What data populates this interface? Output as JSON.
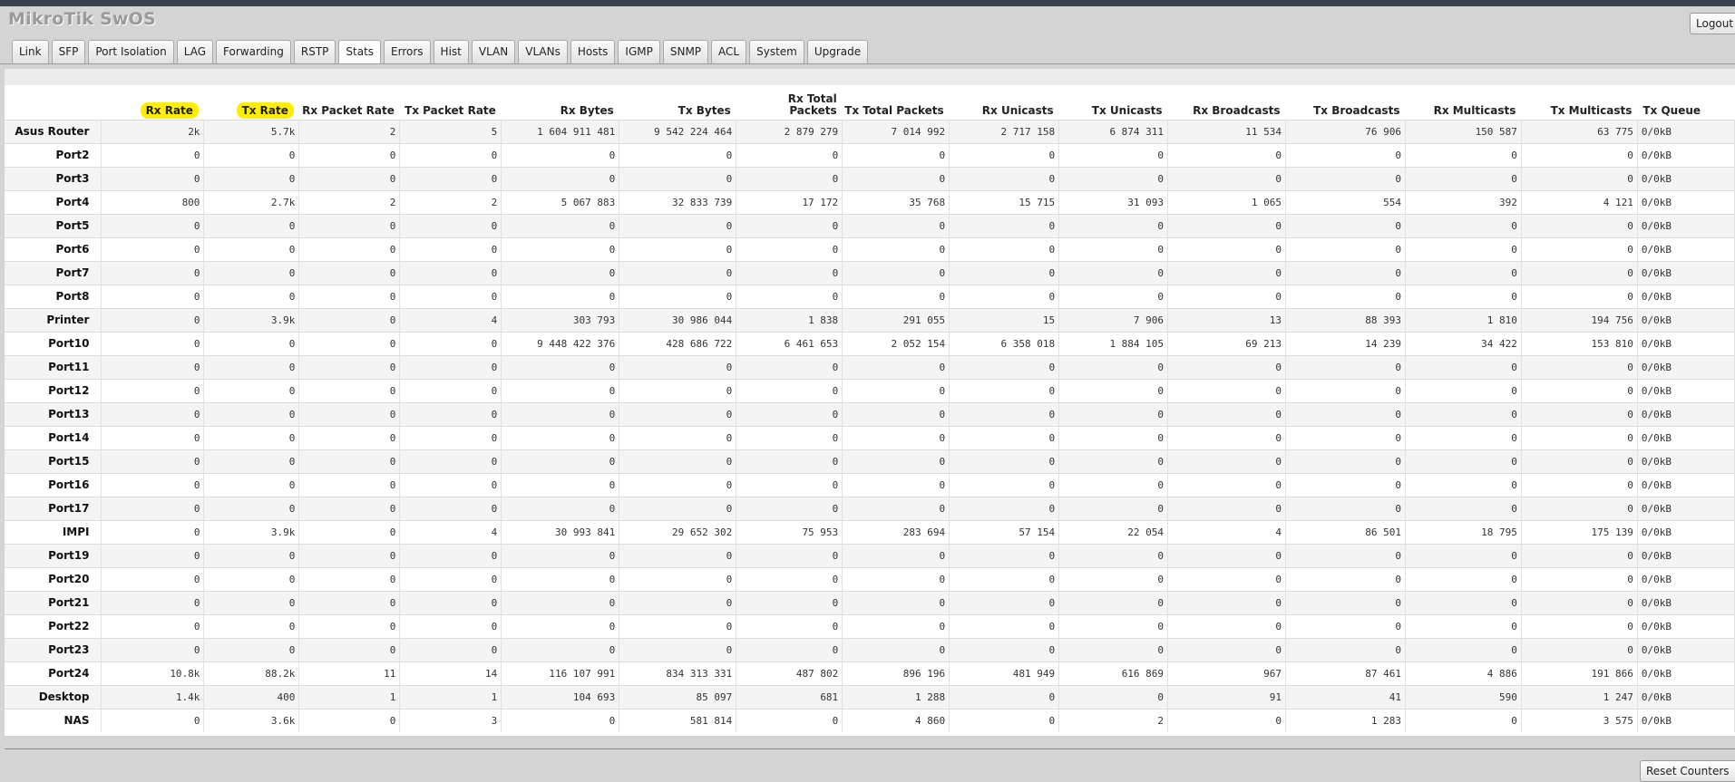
{
  "app_title": "MikroTik SwOS",
  "logout_label": "Logout",
  "reset_label": "Reset Counters",
  "tabs": [
    {
      "label": "Link"
    },
    {
      "label": "SFP"
    },
    {
      "label": "Port Isolation"
    },
    {
      "label": "LAG"
    },
    {
      "label": "Forwarding"
    },
    {
      "label": "RSTP"
    },
    {
      "label": "Stats",
      "active": true
    },
    {
      "label": "Errors"
    },
    {
      "label": "Hist"
    },
    {
      "label": "VLAN"
    },
    {
      "label": "VLANs"
    },
    {
      "label": "Hosts"
    },
    {
      "label": "IGMP"
    },
    {
      "label": "SNMP"
    },
    {
      "label": "ACL"
    },
    {
      "label": "System"
    },
    {
      "label": "Upgrade"
    }
  ],
  "highlight_color": "#ffee00",
  "table": {
    "columns": [
      "",
      "Rx Rate",
      "Tx Rate",
      "Rx Packet Rate",
      "Tx Packet Rate",
      "Rx Bytes",
      "Tx Bytes",
      "Rx Total Packets",
      "Tx Total Packets",
      "Rx Unicasts",
      "Tx Unicasts",
      "Rx Broadcasts",
      "Tx Broadcasts",
      "Rx Multicasts",
      "Tx Multicasts",
      "Tx Queue"
    ],
    "highlighted_columns": [
      1,
      2
    ],
    "rows": [
      [
        "Asus Router",
        "2k",
        "5.7k",
        "2",
        "5",
        "1 604 911 481",
        "9 542 224 464",
        "2 879 279",
        "7 014 992",
        "2 717 158",
        "6 874 311",
        "11 534",
        "76 906",
        "150 587",
        "63 775",
        "0/0kB"
      ],
      [
        "Port2",
        "0",
        "0",
        "0",
        "0",
        "0",
        "0",
        "0",
        "0",
        "0",
        "0",
        "0",
        "0",
        "0",
        "0",
        "0/0kB"
      ],
      [
        "Port3",
        "0",
        "0",
        "0",
        "0",
        "0",
        "0",
        "0",
        "0",
        "0",
        "0",
        "0",
        "0",
        "0",
        "0",
        "0/0kB"
      ],
      [
        "Port4",
        "800",
        "2.7k",
        "2",
        "2",
        "5 067 883",
        "32 833 739",
        "17 172",
        "35 768",
        "15 715",
        "31 093",
        "1 065",
        "554",
        "392",
        "4 121",
        "0/0kB"
      ],
      [
        "Port5",
        "0",
        "0",
        "0",
        "0",
        "0",
        "0",
        "0",
        "0",
        "0",
        "0",
        "0",
        "0",
        "0",
        "0",
        "0/0kB"
      ],
      [
        "Port6",
        "0",
        "0",
        "0",
        "0",
        "0",
        "0",
        "0",
        "0",
        "0",
        "0",
        "0",
        "0",
        "0",
        "0",
        "0/0kB"
      ],
      [
        "Port7",
        "0",
        "0",
        "0",
        "0",
        "0",
        "0",
        "0",
        "0",
        "0",
        "0",
        "0",
        "0",
        "0",
        "0",
        "0/0kB"
      ],
      [
        "Port8",
        "0",
        "0",
        "0",
        "0",
        "0",
        "0",
        "0",
        "0",
        "0",
        "0",
        "0",
        "0",
        "0",
        "0",
        "0/0kB"
      ],
      [
        "Printer",
        "0",
        "3.9k",
        "0",
        "4",
        "303 793",
        "30 986 044",
        "1 838",
        "291 055",
        "15",
        "7 906",
        "13",
        "88 393",
        "1 810",
        "194 756",
        "0/0kB"
      ],
      [
        "Port10",
        "0",
        "0",
        "0",
        "0",
        "9 448 422 376",
        "428 686 722",
        "6 461 653",
        "2 052 154",
        "6 358 018",
        "1 884 105",
        "69 213",
        "14 239",
        "34 422",
        "153 810",
        "0/0kB"
      ],
      [
        "Port11",
        "0",
        "0",
        "0",
        "0",
        "0",
        "0",
        "0",
        "0",
        "0",
        "0",
        "0",
        "0",
        "0",
        "0",
        "0/0kB"
      ],
      [
        "Port12",
        "0",
        "0",
        "0",
        "0",
        "0",
        "0",
        "0",
        "0",
        "0",
        "0",
        "0",
        "0",
        "0",
        "0",
        "0/0kB"
      ],
      [
        "Port13",
        "0",
        "0",
        "0",
        "0",
        "0",
        "0",
        "0",
        "0",
        "0",
        "0",
        "0",
        "0",
        "0",
        "0",
        "0/0kB"
      ],
      [
        "Port14",
        "0",
        "0",
        "0",
        "0",
        "0",
        "0",
        "0",
        "0",
        "0",
        "0",
        "0",
        "0",
        "0",
        "0",
        "0/0kB"
      ],
      [
        "Port15",
        "0",
        "0",
        "0",
        "0",
        "0",
        "0",
        "0",
        "0",
        "0",
        "0",
        "0",
        "0",
        "0",
        "0",
        "0/0kB"
      ],
      [
        "Port16",
        "0",
        "0",
        "0",
        "0",
        "0",
        "0",
        "0",
        "0",
        "0",
        "0",
        "0",
        "0",
        "0",
        "0",
        "0/0kB"
      ],
      [
        "Port17",
        "0",
        "0",
        "0",
        "0",
        "0",
        "0",
        "0",
        "0",
        "0",
        "0",
        "0",
        "0",
        "0",
        "0",
        "0/0kB"
      ],
      [
        "IMPI",
        "0",
        "3.9k",
        "0",
        "4",
        "30 993 841",
        "29 652 302",
        "75 953",
        "283 694",
        "57 154",
        "22 054",
        "4",
        "86 501",
        "18 795",
        "175 139",
        "0/0kB"
      ],
      [
        "Port19",
        "0",
        "0",
        "0",
        "0",
        "0",
        "0",
        "0",
        "0",
        "0",
        "0",
        "0",
        "0",
        "0",
        "0",
        "0/0kB"
      ],
      [
        "Port20",
        "0",
        "0",
        "0",
        "0",
        "0",
        "0",
        "0",
        "0",
        "0",
        "0",
        "0",
        "0",
        "0",
        "0",
        "0/0kB"
      ],
      [
        "Port21",
        "0",
        "0",
        "0",
        "0",
        "0",
        "0",
        "0",
        "0",
        "0",
        "0",
        "0",
        "0",
        "0",
        "0",
        "0/0kB"
      ],
      [
        "Port22",
        "0",
        "0",
        "0",
        "0",
        "0",
        "0",
        "0",
        "0",
        "0",
        "0",
        "0",
        "0",
        "0",
        "0",
        "0/0kB"
      ],
      [
        "Port23",
        "0",
        "0",
        "0",
        "0",
        "0",
        "0",
        "0",
        "0",
        "0",
        "0",
        "0",
        "0",
        "0",
        "0",
        "0/0kB"
      ],
      [
        "Port24",
        "10.8k",
        "88.2k",
        "11",
        "14",
        "116 107 991",
        "834 313 331",
        "487 802",
        "896 196",
        "481 949",
        "616 869",
        "967",
        "87 461",
        "4 886",
        "191 866",
        "0/0kB"
      ],
      [
        "Desktop",
        "1.4k",
        "400",
        "1",
        "1",
        "104 693",
        "85 097",
        "681",
        "1 288",
        "0",
        "0",
        "91",
        "41",
        "590",
        "1 247",
        "0/0kB"
      ],
      [
        "NAS",
        "0",
        "3.6k",
        "0",
        "3",
        "0",
        "581 814",
        "0",
        "4 860",
        "0",
        "2",
        "0",
        "1 283",
        "0",
        "3 575",
        "0/0kB"
      ]
    ],
    "highlighted_row": 25
  }
}
